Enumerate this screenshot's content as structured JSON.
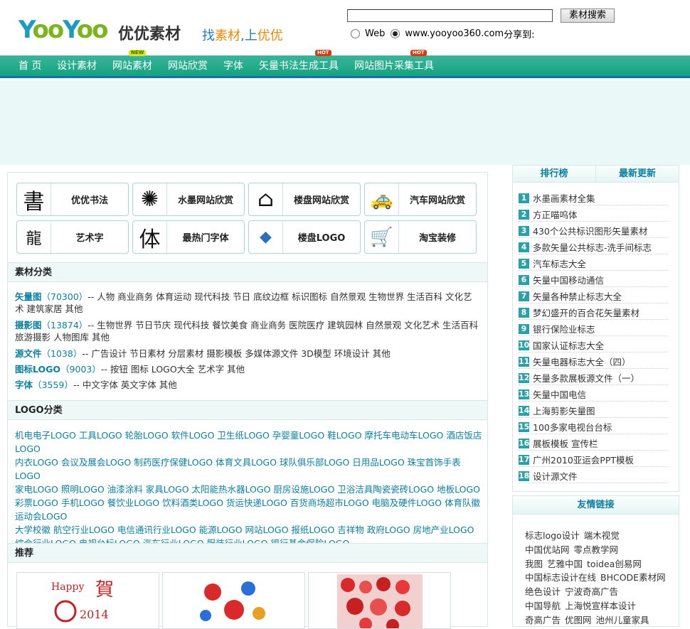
{
  "header": {
    "logo_text": "YooYoo",
    "logo_cn": "优优素材",
    "slogan_find": "找",
    "slogan_material": "素材",
    "slogan_sep": ",上",
    "slogan_yy": "优优",
    "search_value": "",
    "search_button": "素材搜索",
    "radio_web": "Web",
    "radio_site": "www.yooyoo360.com",
    "share_text": "分享到:"
  },
  "nav": {
    "items": [
      "首 页",
      "设计素材",
      "网站素材",
      "网站欣赏",
      "字体",
      "矢量书法生成工具",
      "网站图片采集工具"
    ],
    "badge_new": "NEW",
    "badge_hot": "HOT"
  },
  "tiles": [
    {
      "label": "优优书法",
      "icon": "calligraphy-icon",
      "glyph": "書"
    },
    {
      "label": "水墨网站欣赏",
      "icon": "ink-splash-icon",
      "glyph": "✺"
    },
    {
      "label": "楼盘网站欣赏",
      "icon": "house-icon",
      "glyph": "⌂"
    },
    {
      "label": "汽车网站欣赏",
      "icon": "car-icon",
      "glyph": "🚕"
    },
    {
      "label": "艺术字",
      "icon": "art-text-icon",
      "glyph": "龍"
    },
    {
      "label": "最热门字体",
      "icon": "font-icon",
      "glyph": "体"
    },
    {
      "label": "楼盘LOGO",
      "icon": "building-logo-icon",
      "glyph": "◆"
    },
    {
      "label": "淘宝装修",
      "icon": "shopping-cart-icon",
      "glyph": "🛒"
    }
  ],
  "sections": {
    "material_category": "素材分类",
    "logo_category": "LOGO分类",
    "recommend": "推荐"
  },
  "categories": [
    {
      "name": "矢量图",
      "count": "（70300）",
      "items": "-- 人物 商业商务 体育运动 现代科技 节日 底纹边框 标识图标 自然景观 生物世界 生活百科 文化艺术 建筑家居 其他"
    },
    {
      "name": "摄影图",
      "count": "（13874）",
      "items": "-- 生物世界 节日节庆 现代科技 餐饮美食 商业商务 医院医疗 建筑园林 自然景观 文化艺术 生活百科 旅游摄影 人物图库 其他"
    },
    {
      "name": "源文件",
      "count": "（1038）",
      "items": "-- 广告设计 节日素材 分层素材 摄影模板 多媒体源文件 3D模型 环境设计 其他"
    },
    {
      "name": "图标LOGO",
      "count": "（9003）",
      "items": "-- 按钮 图标 LOGO大全 艺术字 其他"
    },
    {
      "name": "字体",
      "count": "（3559）",
      "items": "-- 中文字体 英文字体 其他"
    }
  ],
  "logo_lines": [
    "机电电子LOGO 工具LOGO 轮胎LOGO 软件LOGO 卫生纸LOGO 孕婴童LOGO 鞋LOGO 摩托车电动车LOGO 酒店饭店LOGO",
    "内衣LOGO 会议及展会LOGO 制药医疗保健LOGO 体育文具LOGO 球队俱乐部LOGO 日用品LOGO 珠宝首饰手表LOGO",
    "家电LOGO 照明LOGO 油漆涂料 家具LOGO 太阳能热水器LOGO 厨房设施LOGO 卫浴洁具陶瓷瓷砖LOGO 地板LOGO",
    "彩票LOGO 手机LOGO 餐饮业LOGO 饮料酒类LOGO 货运快递LOGO 百货商场超市LOGO 电脑及硬件LOGO 体育队徽运动会LOGO",
    "大学校徽 航空行业LOGO 电信通讯行业LOGO 能源LOGO 网站LOGO 报纸LOGO 吉祥物 政府LOGO 房地产业LOGO",
    "综合行业LOGO 电视台标LOGO 汽车行业LOGO 服装行业LOGO 银行基金保险LOGO"
  ],
  "sidebar": {
    "tab_rank": "排行榜",
    "tab_new": "最新更新",
    "rank": [
      "水墨画素材全集",
      "方正喵呜体",
      "430个公共标识图形矢量素材",
      "多款矢量公共标志-洗手间标志",
      "汽车标志大全",
      "矢量中国移动通信",
      "矢量各种禁止标志大全",
      "梦幻盛开的百合花矢量素材",
      "银行保险业标志",
      "国家认证标志大全",
      "矢量电器标志大全（四）",
      "矢量多款展板源文件（一）",
      "矢量中国电信",
      "上海剪影矢量图",
      "100多家电视台台标",
      "展板模板 宣传栏",
      "广州2010亚运会PPT模板",
      "设计源文件"
    ],
    "friends_title": "友情链接",
    "friends": [
      [
        "标志logo设计",
        "端木视觉"
      ],
      [
        "中国优站网",
        "零点教学网"
      ],
      [
        "我图",
        "艺雅中国",
        "toidea创易网"
      ],
      [
        "中国标志设计在线",
        "BHCODE素材网"
      ],
      [
        "绝色设计",
        "宁波奇高广告"
      ],
      [
        "中国导航",
        "上海悦宣样本设计"
      ],
      [
        "奇高广告",
        "优图网",
        "池州儿童家具"
      ]
    ]
  }
}
